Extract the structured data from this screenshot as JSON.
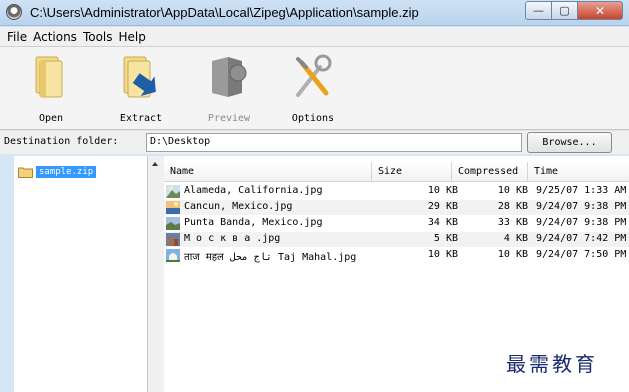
{
  "window": {
    "title": "C:\\Users\\Administrator\\AppData\\Local\\Zipeg\\Application\\sample.zip",
    "minimize_label": "—",
    "maximize_label": "▢",
    "close_label": "✕"
  },
  "menu": {
    "items": [
      {
        "label": "File"
      },
      {
        "label": "Actions"
      },
      {
        "label": "Tools"
      },
      {
        "label": "Help"
      }
    ]
  },
  "toolbar": {
    "open_label": "Open",
    "extract_label": "Extract",
    "preview_label": "Preview",
    "options_label": "Options"
  },
  "destination": {
    "label": "Destination folder:",
    "value": "D:\\Desktop",
    "browse_label": "Browse..."
  },
  "tree": {
    "items": [
      {
        "label": "sample.zip"
      }
    ]
  },
  "file_list": {
    "columns": {
      "name": "Name",
      "size": "Size",
      "compressed": "Compressed",
      "time": "Time"
    },
    "rows": [
      {
        "name": "Alameda, California.jpg",
        "size": "10 KB",
        "compressed": "10 KB",
        "time": "9/25/07 1:33 AM"
      },
      {
        "name": "Cancun, Mexico.jpg",
        "size": "29 KB",
        "compressed": "28 KB",
        "time": "9/24/07 9:38 PM"
      },
      {
        "name": "Punta Banda, Mexico.jpg",
        "size": "34 KB",
        "compressed": "33 KB",
        "time": "9/24/07 9:38 PM"
      },
      {
        "name": "М о с к в а .jpg",
        "size": "5 KB",
        "compressed": "4 KB",
        "time": "9/24/07 7:42 PM"
      },
      {
        "name": "ताज महल تاج محل Taj Mahal.jpg",
        "size": "10 KB",
        "compressed": "10 KB",
        "time": "9/24/07 7:50 PM"
      }
    ]
  },
  "watermark": "最需教育"
}
